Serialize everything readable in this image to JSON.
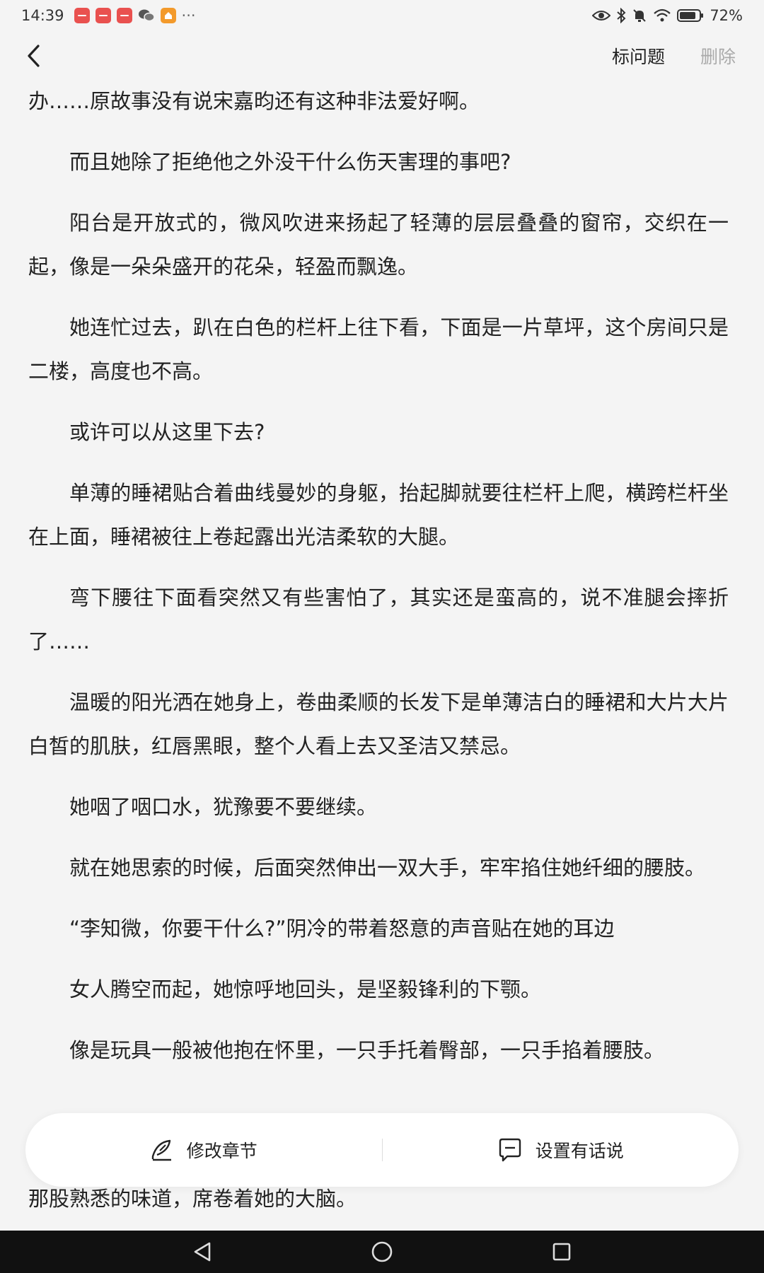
{
  "status_bar": {
    "time": "14:39",
    "more": "···",
    "battery_percent": "72%",
    "icons": [
      "red-app-icon",
      "red-app-icon",
      "red-app-icon",
      "wechat-icon",
      "orange-app-icon",
      "eye-icon",
      "bluetooth-icon",
      "mute-icon",
      "wifi-icon",
      "battery-icon"
    ]
  },
  "header": {
    "back_icon": "back-icon",
    "title_button": "标问题",
    "delete_button": "删除"
  },
  "content": {
    "paragraphs": [
      "办……原故事没有说宋嘉昀还有这种非法爱好啊。",
      "而且她除了拒绝他之外没干什么伤天害理的事吧?",
      "阳台是开放式的，微风吹进来扬起了轻薄的层层叠叠的窗帘，交织在一起，像是一朵朵盛开的花朵，轻盈而飘逸。",
      "她连忙过去，趴在白色的栏杆上往下看，下面是一片草坪，这个房间只是二楼，高度也不高。",
      "或许可以从这里下去?",
      "单薄的睡裙贴合着曲线曼妙的身躯，抬起脚就要往栏杆上爬，横跨栏杆坐在上面，睡裙被往上卷起露出光洁柔软的大腿。",
      "弯下腰往下面看突然又有些害怕了，其实还是蛮高的，说不准腿会摔折了……",
      "温暖的阳光洒在她身上，卷曲柔顺的长发下是单薄洁白的睡裙和大片大片白皙的肌肤，红唇黑眼，整个人看上去又圣洁又禁忌。",
      "她咽了咽口水，犹豫要不要继续。",
      "就在她思索的时候，后面突然伸出一双大手，牢牢掐住她纤细的腰肢。",
      "“李知微，你要干什么?”阴冷的带着怒意的声音贴在她的耳边",
      "女人腾空而起，她惊呼地回头，是坚毅锋利的下颚。",
      "像是玩具一般被他抱在怀里，一只手托着臀部，一只手掐着腰肢。"
    ],
    "last_line": "那股熟悉的味道，席卷着她的大脑。"
  },
  "bottom_card": {
    "edit_chapter": "修改章节",
    "edit_icon": "pen-icon",
    "author_note": "设置有话说",
    "note_icon": "comment-icon"
  },
  "nav_bar": {
    "icons": [
      "back-triangle-icon",
      "home-circle-icon",
      "recents-square-icon"
    ]
  }
}
